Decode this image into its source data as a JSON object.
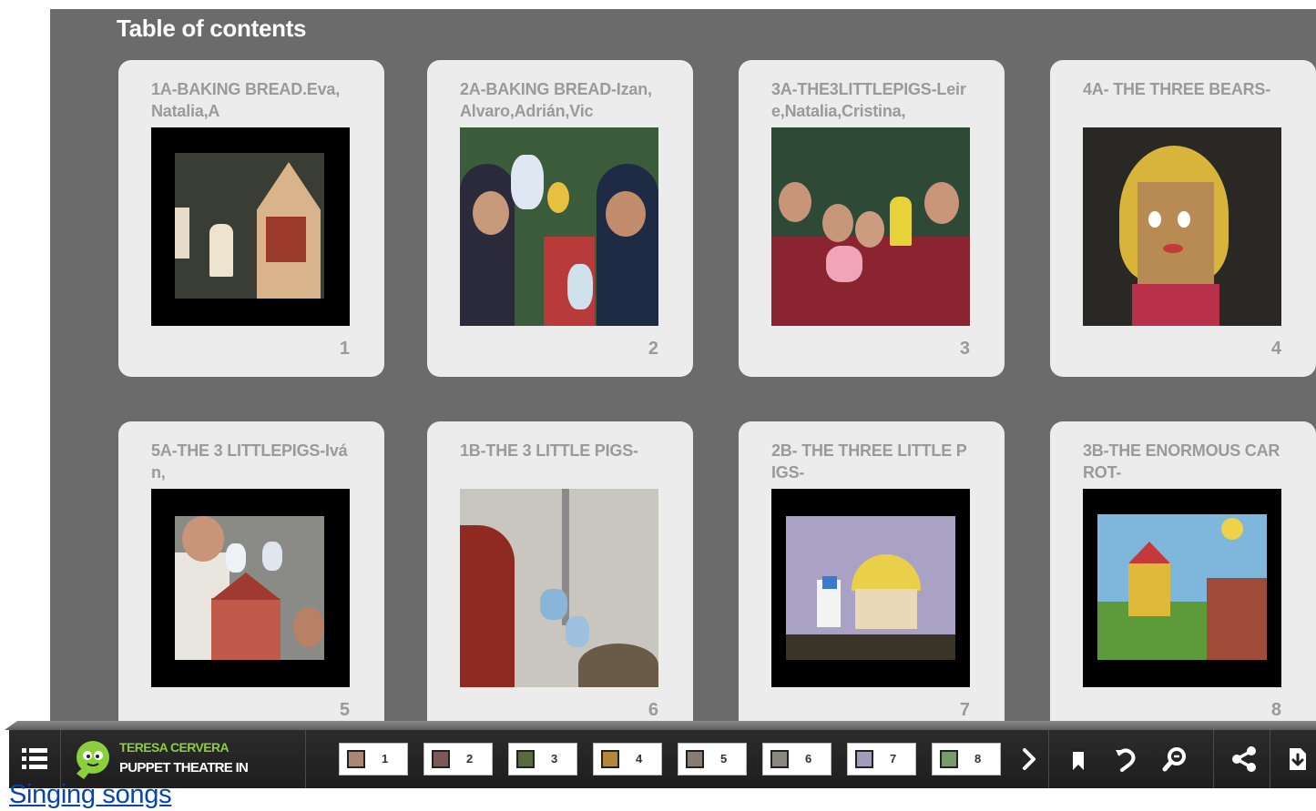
{
  "toc": {
    "title": "Table of contents",
    "cards": [
      {
        "title": "1A-BAKING BREAD.Eva,Natalia,A",
        "page": "1"
      },
      {
        "title": "2A-BAKING BREAD-Izan,Alvaro,Adrián,Vic",
        "page": "2"
      },
      {
        "title": "3A-THE3LITTLEPIGS-Leire,Natalia,Cristina,",
        "page": "3"
      },
      {
        "title": "4A- THE THREE BEARS-",
        "page": "4"
      },
      {
        "title": "5A-THE 3 LITTLEPIGS-Iván,",
        "page": "5"
      },
      {
        "title": "1B-THE 3 LITTLE PIGS-",
        "page": "6"
      },
      {
        "title": "2B- THE THREE LITTLE PIGS-",
        "page": "7"
      },
      {
        "title": "3B-THE ENORMOUS CARROT-",
        "page": "8"
      }
    ]
  },
  "toolbar": {
    "author": "TERESA CERVERA",
    "book_title": "PUPPET THEATRE IN",
    "pages": [
      "1",
      "2",
      "3",
      "4",
      "5",
      "6",
      "7",
      "8"
    ],
    "icons": [
      "list-icon",
      "chevron-right-icon",
      "bookmark-icon",
      "rotate-icon",
      "zoom-icon",
      "share-icon",
      "download-icon"
    ],
    "colors": {
      "author": "#8ccf3c",
      "bar": "#222222"
    }
  },
  "footer": {
    "link_text": "Singing songs"
  }
}
